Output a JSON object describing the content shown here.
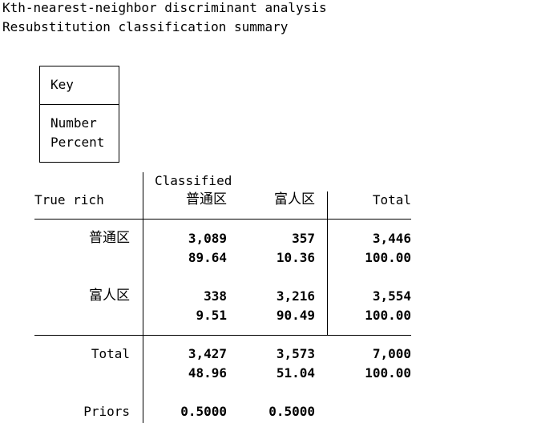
{
  "title": "Kth-nearest-neighbor discriminant analysis",
  "subtitle": "Resubstitution classification summary",
  "key": {
    "header": "Key",
    "lines": [
      "Number",
      "Percent"
    ]
  },
  "table": {
    "row_header": "True rich",
    "col_super_header": "Classified",
    "columns": [
      "普通区",
      "富人区",
      "Total"
    ],
    "rows": [
      {
        "label": "普通区",
        "numbers": [
          "3,089",
          "357",
          "3,446"
        ],
        "percents": [
          "89.64",
          "10.36",
          "100.00"
        ]
      },
      {
        "label": "富人区",
        "numbers": [
          "338",
          "3,216",
          "3,554"
        ],
        "percents": [
          "9.51",
          "90.49",
          "100.00"
        ]
      }
    ],
    "total": {
      "label": "Total",
      "numbers": [
        "3,427",
        "3,573",
        "7,000"
      ],
      "percents": [
        "48.96",
        "51.04",
        "100.00"
      ]
    },
    "priors": {
      "label": "Priors",
      "values": [
        "0.5000",
        "0.5000"
      ]
    }
  }
}
